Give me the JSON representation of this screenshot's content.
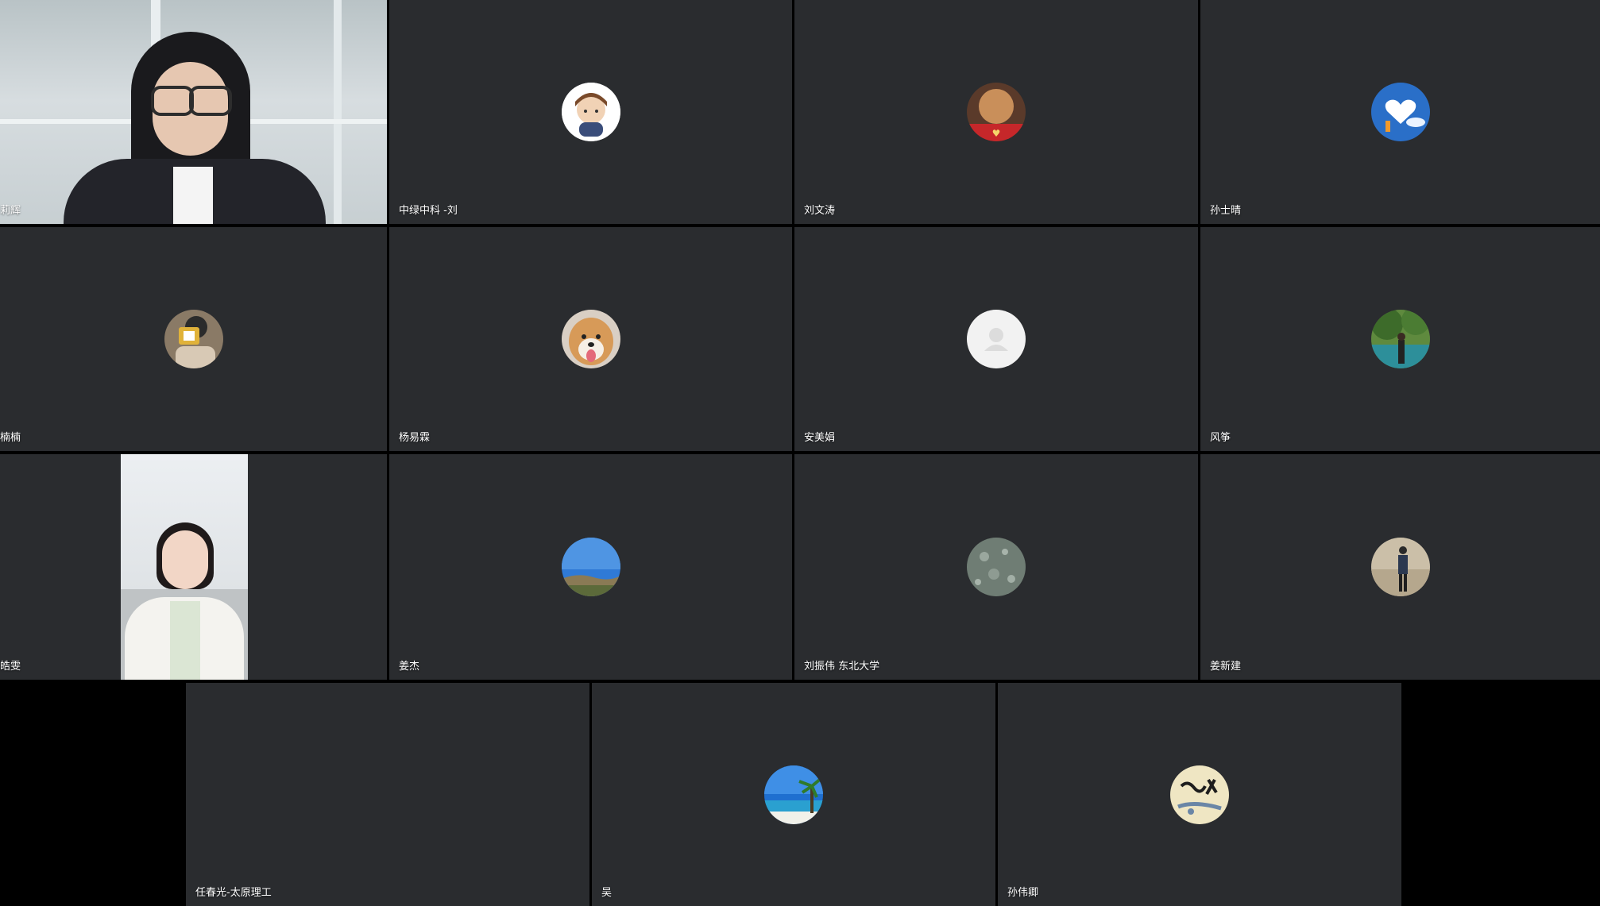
{
  "meeting": {
    "participants": [
      {
        "name": "莉辉",
        "video": true,
        "speaking": true
      },
      {
        "name": "中绿中科 -刘",
        "avatar_icon": "cartoon-boy-avatar-icon"
      },
      {
        "name": "刘文涛",
        "avatar_icon": "china-heart-avatar-icon"
      },
      {
        "name": "孙士晴",
        "avatar_icon": "heart-sky-avatar-icon"
      },
      {
        "name": "楠楠",
        "avatar_icon": "person-photo-avatar-icon"
      },
      {
        "name": "杨易霖",
        "avatar_icon": "shiba-dog-avatar-icon"
      },
      {
        "name": "安美娟",
        "avatar_icon": "default-user-avatar-icon"
      },
      {
        "name": "风筝",
        "avatar_icon": "tree-person-avatar-icon"
      },
      {
        "name": "皓雯",
        "video": true
      },
      {
        "name": "姜杰",
        "avatar_icon": "sky-landscape-avatar-icon"
      },
      {
        "name": "刘振伟 东北大学",
        "avatar_icon": "rain-window-avatar-icon"
      },
      {
        "name": "姜新建",
        "avatar_icon": "person-desert-avatar-icon"
      },
      {
        "name": "任春光-太原理工"
      },
      {
        "name": "吴",
        "avatar_icon": "beach-palm-avatar-icon"
      },
      {
        "name": "孙伟卿",
        "avatar_icon": "calligraphy-avatar-icon"
      }
    ]
  },
  "colors": {
    "tile_background": "#2a2c2f",
    "page_background": "#000000",
    "speaking_border": "#5fcf6b"
  }
}
